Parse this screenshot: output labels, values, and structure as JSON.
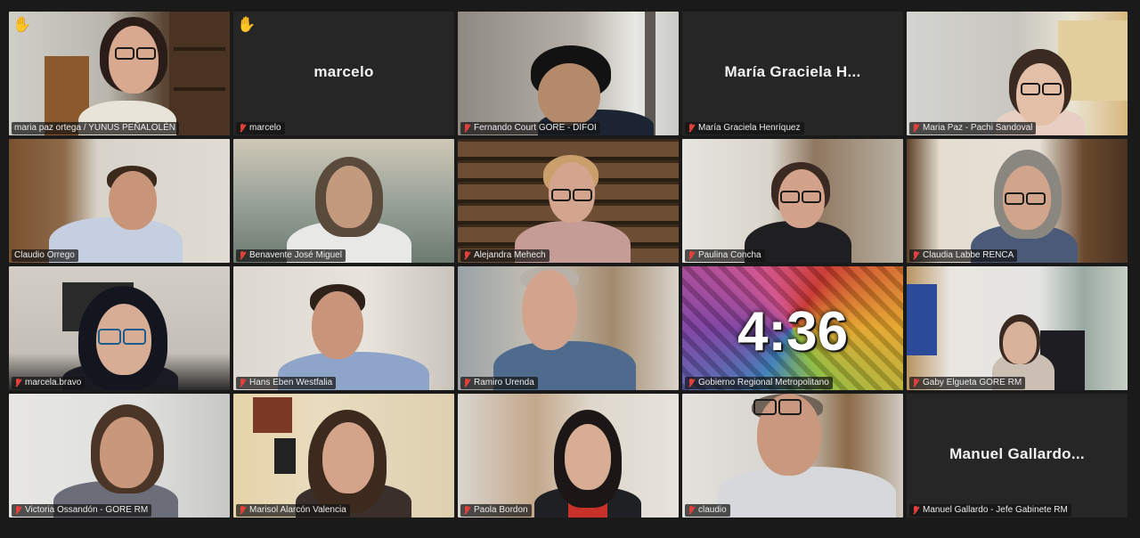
{
  "tiles": [
    {
      "name": "maria paz ortega / YUNUS PEÑALOLÉN",
      "muted": false,
      "hand": true
    },
    {
      "name": "marcelo",
      "muted": true,
      "display": "marcelo",
      "hand": true
    },
    {
      "name": "Fernando Court GORE - DIFOI",
      "muted": true
    },
    {
      "name": "María Graciela Henríquez",
      "muted": true,
      "display": "María Graciela H..."
    },
    {
      "name": "Maria Paz - Pachi Sandoval",
      "muted": true
    },
    {
      "name": "Claudio Orrego",
      "muted": false
    },
    {
      "name": "Benavente José Miguel",
      "muted": true
    },
    {
      "name": "Alejandra Mehech",
      "muted": true
    },
    {
      "name": "Paulina Concha",
      "muted": true
    },
    {
      "name": "Claudia Labbe RENCA",
      "muted": true
    },
    {
      "name": "marcela.bravo",
      "muted": true
    },
    {
      "name": "Hans Eben Westfalia",
      "muted": true
    },
    {
      "name": "Ramiro Urenda",
      "muted": true
    },
    {
      "name": "Gobierno Regional Metropolitano",
      "muted": true,
      "timer": "4:36"
    },
    {
      "name": "Gaby Elgueta GORE RM",
      "muted": true
    },
    {
      "name": "Victoria Ossandón - GORE RM",
      "muted": true
    },
    {
      "name": "Marisol Alarcón Valencia",
      "muted": true
    },
    {
      "name": "Paola Bordon",
      "muted": true
    },
    {
      "name": "claudio",
      "muted": true
    },
    {
      "name": "Manuel Gallardo - Jefe Gabinete RM",
      "muted": true,
      "display": "Manuel  Gallardo..."
    }
  ],
  "icons": {
    "hand": "raised-hand-icon",
    "mic": "muted-mic-icon"
  },
  "colors": {
    "active_border": "#a9d64a",
    "muted_mic": "#e2403a",
    "background": "#1a1a1a"
  }
}
